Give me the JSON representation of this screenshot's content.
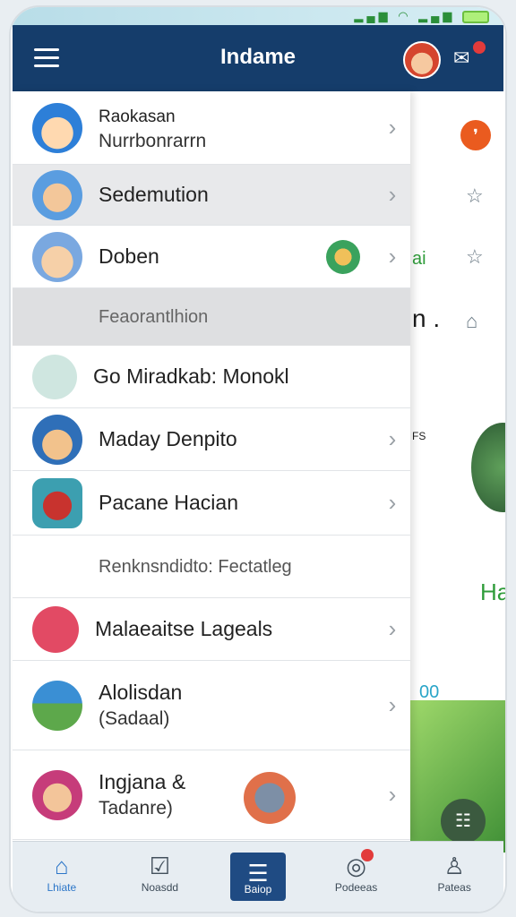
{
  "header": {
    "title": "Indame"
  },
  "drawer": {
    "items": [
      {
        "line1": "Raokasan",
        "line2": "Nurrbonrarrn",
        "icon": "king-avatar-icon"
      },
      {
        "line1": "Sedemution",
        "icon": "kids-avatar-icon"
      },
      {
        "line1": "Doben",
        "icon": "boy-avatar-icon"
      },
      {
        "section": "Feaorantlhion"
      },
      {
        "line1": "Go Miradkab: Monokl",
        "icon": "teal-circle-icon"
      },
      {
        "line1": "Maday Denpito",
        "icon": "pirate-avatar-icon"
      },
      {
        "line1": "Pacane Hacian",
        "icon": "girl-avatar-icon"
      },
      {
        "section": "Renknsndidto: Fectatleg"
      },
      {
        "line1": "Malaeaitse Lageals",
        "icon": "pink-circle-icon"
      },
      {
        "line1": "Alolisdan",
        "line2": "(Sadaal)",
        "icon": "landscape-icon"
      },
      {
        "line1": "Ingjana &",
        "line2": "Tadanre)",
        "icon": "clown-avatar-icon"
      }
    ]
  },
  "rightpane": {
    "text1": "ai",
    "text2": "n .",
    "text3": "FS",
    "text4": "Ha",
    "text5": "00"
  },
  "bottomnav": {
    "tabs": [
      {
        "label": "Lhiate",
        "icon": "home-icon"
      },
      {
        "label": "Noasdd",
        "icon": "inbox-icon"
      },
      {
        "label": "Baiop",
        "icon": "list-icon"
      },
      {
        "label": "Podeeas",
        "icon": "chat-icon"
      },
      {
        "label": "Pateas",
        "icon": "person-icon"
      }
    ]
  },
  "colors": {
    "topbar": "#153d6b",
    "accent": "#1f4b83",
    "orange": "#ea5b1f"
  }
}
